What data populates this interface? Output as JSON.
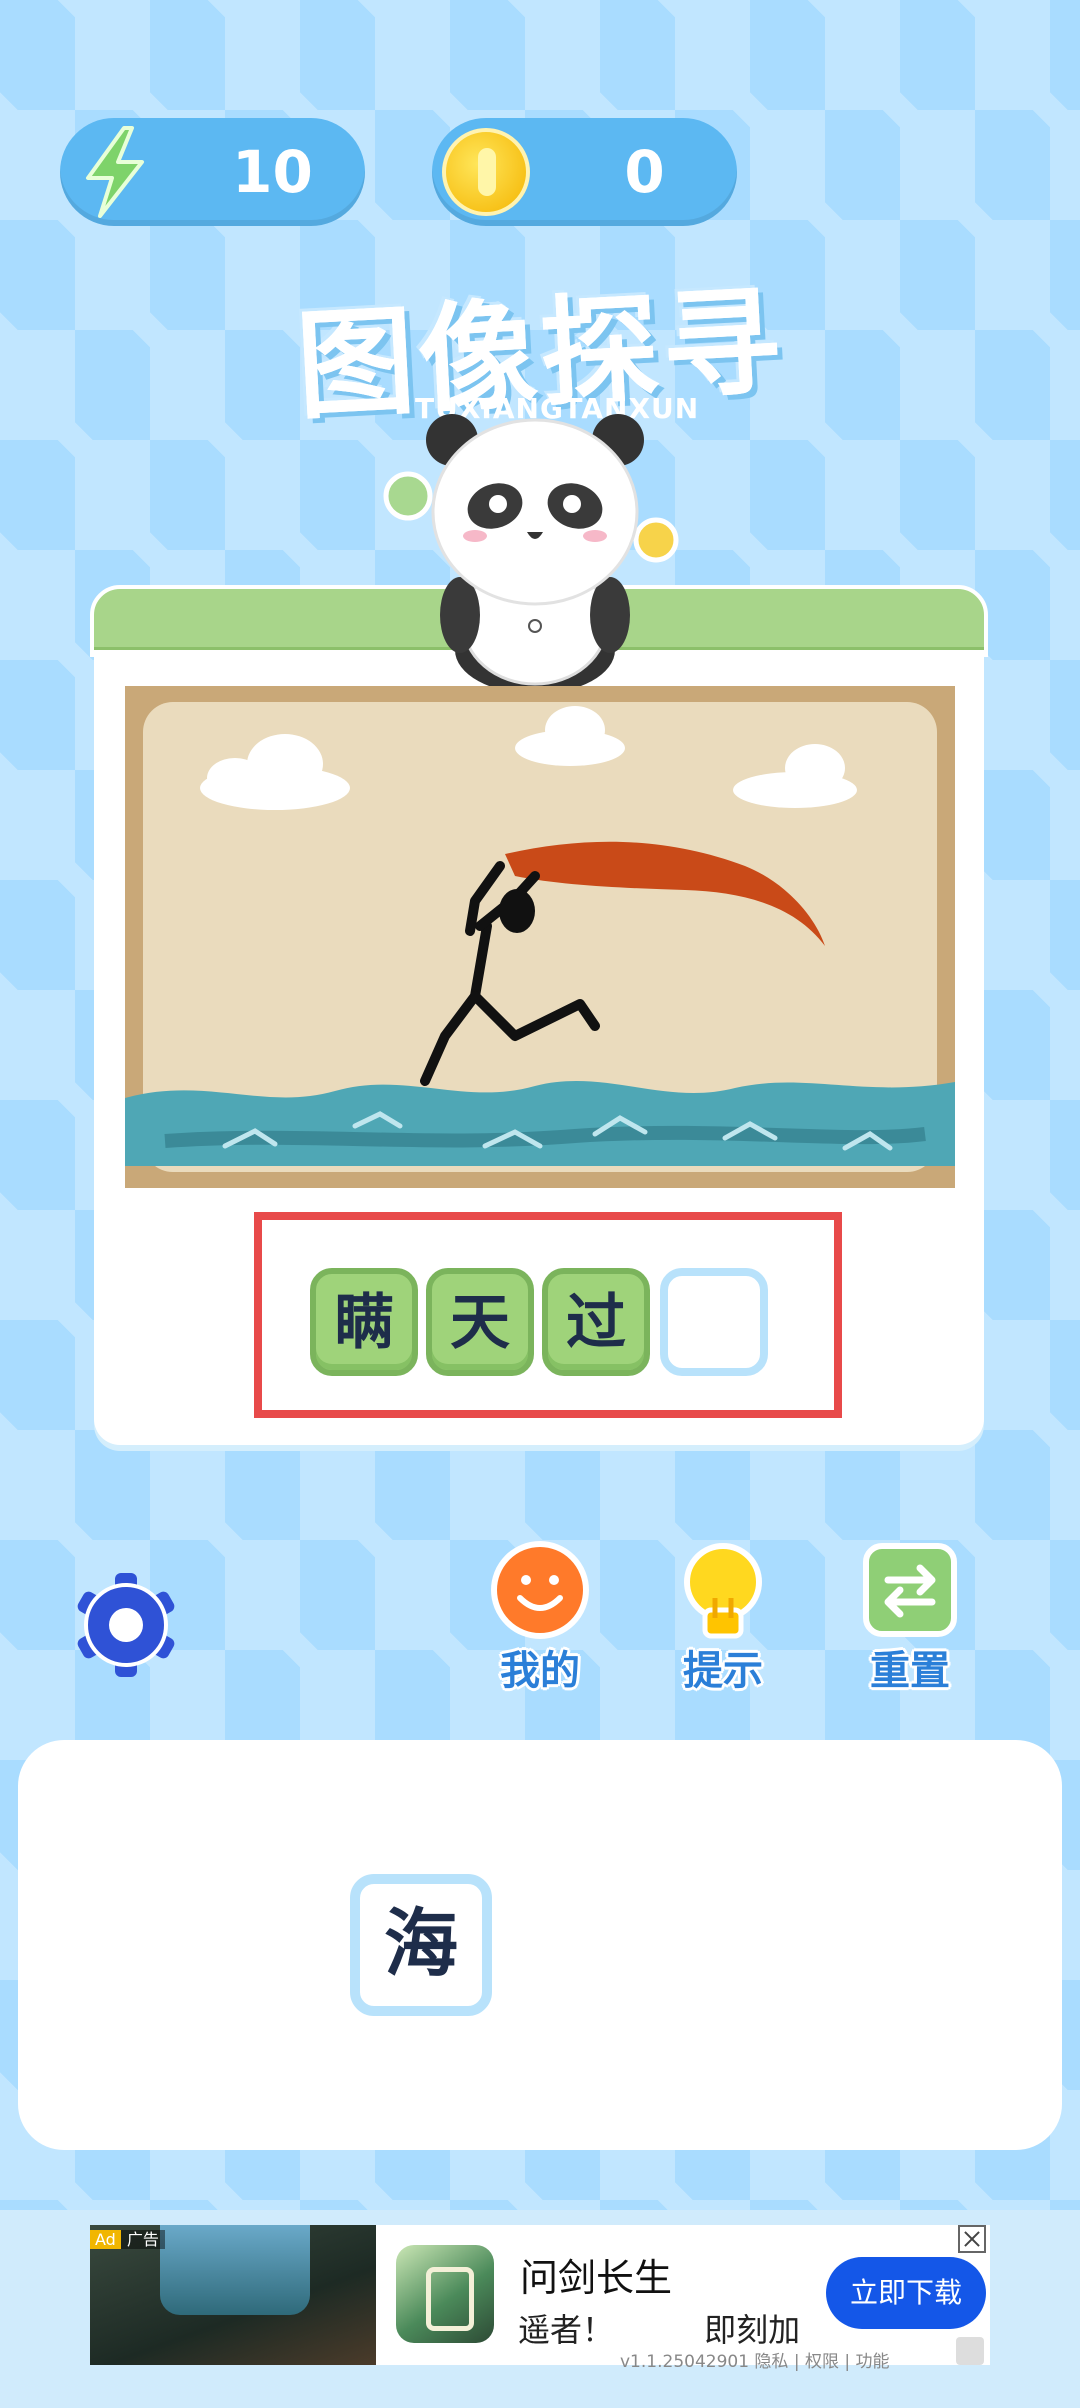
{
  "hud": {
    "energy": "10",
    "coins": "0"
  },
  "title": {
    "main": "图像探寻",
    "sub": "TUXIANGTANXUN"
  },
  "puzzle": {
    "slots": [
      "瞒",
      "天",
      "过",
      ""
    ]
  },
  "tools": [
    {
      "label": "我的",
      "icon": "smiley-icon"
    },
    {
      "label": "提示",
      "icon": "lightbulb-icon"
    },
    {
      "label": "重置",
      "icon": "swap-icon"
    }
  ],
  "candidates": [
    "海"
  ],
  "ad": {
    "badge": "Ad",
    "badge_label": "广告",
    "title": "问剑长生",
    "desc": "遥者！ 即刻加",
    "cta": "立即下载",
    "version": "v1.1.25042901 隐私 | 权限 | 功能"
  },
  "colors": {
    "accent": "#2b7fd8",
    "tile_green": "#9fd37a",
    "highlight_red": "#e84a4a",
    "cta_blue": "#1457e8"
  }
}
